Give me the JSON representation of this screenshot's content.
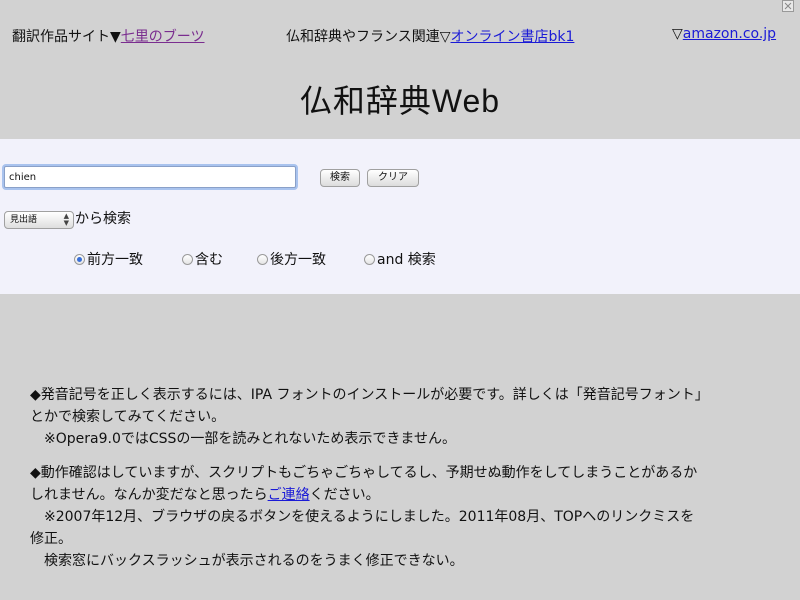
{
  "nav": {
    "prefix1": "翻訳作品サイト▼",
    "link1": "七里のブーツ",
    "prefix2": "仏和辞典やフランス関連▽",
    "link2": "オンライン書店bk1",
    "prefix3": "▽",
    "link3": "amazon.co.jp"
  },
  "title": "仏和辞典Web",
  "search": {
    "value": "chien",
    "search_label": "検索",
    "clear_label": "クリア",
    "field_selected": "見出語",
    "from_label": "から検索",
    "options": [
      "前方一致",
      "含む",
      "後方一致",
      "and 検索"
    ],
    "selected_option": "前方一致"
  },
  "notes": {
    "line1": "◆発音記号を正しく表示するには、IPA フォントのインストールが必要です。詳しくは「発音記号フォント」",
    "line2": "とかで検索してみてください。",
    "line3": "※Opera9.0ではCSSの一部を読みとれないため表示できません。",
    "line4": "◆動作確認はしていますが、スクリプトもごちゃごちゃしてるし、予期せぬ動作をしてしまうことがあるか",
    "line5_pre": "しれません。なんか変だなと思ったら",
    "line5_link": "ご連絡",
    "line5_post": "ください。",
    "line6": "※2007年12月、ブラウザの戻るボタンを使えるようにしました。2011年08月、TOPへのリンクミスを",
    "line7": "修正。",
    "line8": "検索窓にバックスラッシュが表示されるのをうまく修正できない。"
  }
}
